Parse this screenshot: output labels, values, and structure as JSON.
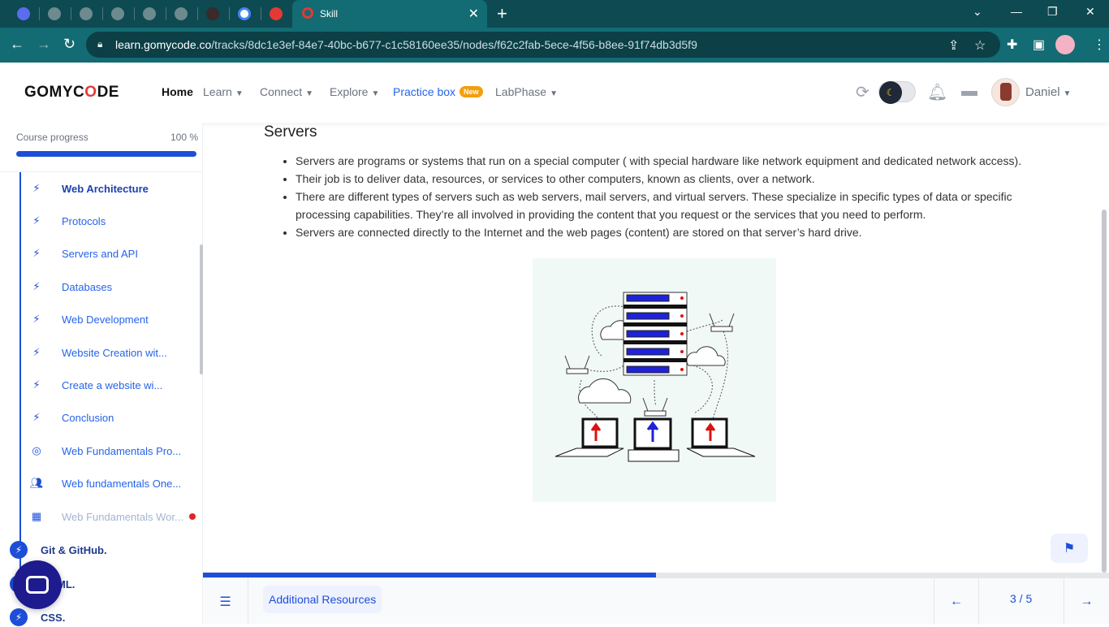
{
  "browser": {
    "tab_title": "Skill",
    "url_domain": "learn.gomycode.co",
    "url_path": "/tracks/8dc1e3ef-84e7-40bc-b677-c1c58160ee35/nodes/f62c2fab-5ece-4f56-b8ee-91f74db3d5f9"
  },
  "header": {
    "logo": "GOMYCODE",
    "nav": {
      "home": "Home",
      "learn": "Learn",
      "connect": "Connect",
      "explore": "Explore",
      "practice": "Practice box",
      "practice_badge": "New",
      "labphase": "LabPhase"
    },
    "user_name": "Daniel"
  },
  "sidebar": {
    "progress_label": "Course progress",
    "progress_value": "100 %",
    "progress_fraction": 1.0,
    "items": [
      {
        "label": "Web Architecture",
        "icon": "bolt-icon"
      },
      {
        "label": "Protocols",
        "icon": "bolt-icon"
      },
      {
        "label": "Servers and API",
        "icon": "bolt-icon"
      },
      {
        "label": "Databases",
        "icon": "bolt-icon"
      },
      {
        "label": "Web Development",
        "icon": "bolt-icon"
      },
      {
        "label": "Website Creation wit...",
        "icon": "bolt-icon"
      },
      {
        "label": "Create a website wi...",
        "icon": "bolt-icon"
      },
      {
        "label": "Conclusion",
        "icon": "bolt-icon"
      },
      {
        "label": "Web Fundamentals Pro...",
        "icon": "target-icon"
      },
      {
        "label": "Web fundamentals One...",
        "icon": "people-icon"
      },
      {
        "label": "Web Fundamentals Wor...",
        "icon": "workshop-icon"
      }
    ],
    "modules": [
      {
        "label": "Git & GitHub."
      },
      {
        "label": "ML."
      },
      {
        "label": "CSS."
      }
    ]
  },
  "content": {
    "heading": "Servers",
    "bullets": [
      "Servers are programs or systems that run on a special computer ( with special hardware like network equipment and dedicated network access).",
      "Their job is to deliver data, resources, or services to other computers, known as clients, over a network.",
      "There are different types of servers such as web servers, mail servers, and virtual servers. These specialize in specific types of data or specific processing capabilities. They’re all involved in providing the content that you request or the services that you need to perform.",
      "Servers are connected directly to the Internet and the web pages (content) are stored on that server’s hard drive."
    ]
  },
  "footer": {
    "additional_resources": "Additional Resources",
    "page_indicator": "3 / 5",
    "progress_fraction": 0.5
  },
  "colors": {
    "accent": "#1d4ed8",
    "browser_chrome": "#136b73",
    "badge_new": "#f59e0b",
    "logo_accent": "#e53935"
  }
}
